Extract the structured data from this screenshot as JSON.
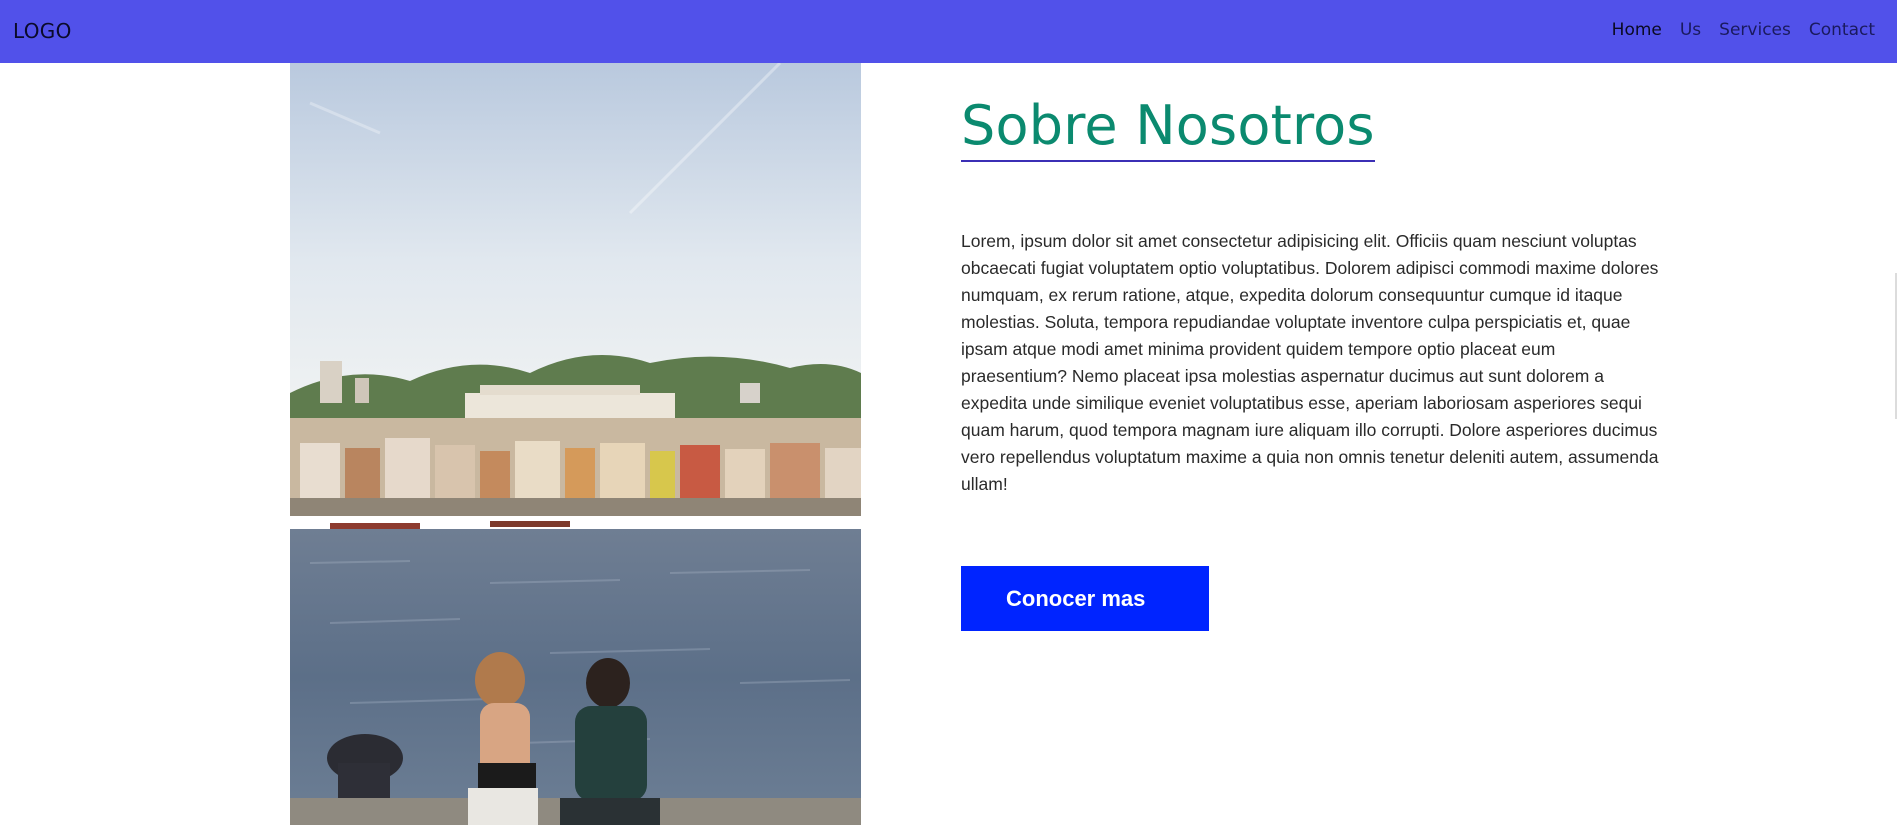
{
  "nav": {
    "logo": "LOGO",
    "links": [
      "Home",
      "Us",
      "Services",
      "Contact"
    ]
  },
  "about": {
    "title": "Sobre Nosotros",
    "body": "Lorem, ipsum dolor sit amet consectetur adipisicing elit. Officiis quam nesciunt voluptas obcaecati fugiat voluptatem optio voluptatibus. Dolorem adipisci commodi maxime dolores numquam, ex rerum ratione, atque, expedita dolorum consequuntur cumque id itaque molestias. Soluta, tempora repudiandae voluptate inventore culpa perspiciatis et, quae ipsam atque modi amet minima provident quidem tempore optio placeat eum praesentium? Nemo placeat ipsa molestias aspernatur ducimus aut sunt dolorem a expedita unde similique eveniet voluptatibus esse, aperiam laboriosam asperiores sequi quam harum, quod tempora magnam iure aliquam illo corrupti. Dolore asperiores ducimus vero repellendus voluptatum maxime a quia non omnis tenetur deleniti autem, assumenda ullam!",
    "button_label": "Conocer mas"
  },
  "colors": {
    "navbar_bg": "#5151ea",
    "title": "#0b8a6f",
    "title_underline": "#3b2fb5",
    "button_bg": "#0024ff"
  }
}
